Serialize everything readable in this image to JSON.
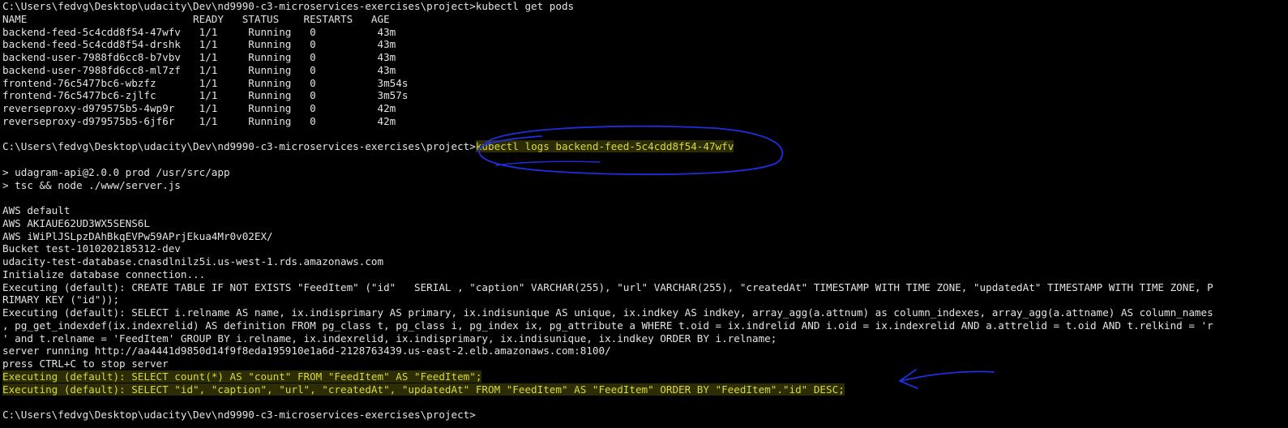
{
  "window": {
    "type": "command-prompt-terminal"
  },
  "colors": {
    "background": "#000000",
    "foreground": "#d4d4d4",
    "highlight_text": "#d9d938",
    "annotation": "#1f2fe0"
  },
  "lines": [
    {
      "text": "C:\\Users\\fedvg\\Desktop\\udacity\\Dev\\nd9990-c3-microservices-exercises\\project>kubectl get pods",
      "style": "normal"
    },
    {
      "text": "NAME                           READY   STATUS    RESTARTS   AGE",
      "style": "normal"
    },
    {
      "text": "backend-feed-5c4cdd8f54-47wfv   1/1     Running   0          43m",
      "style": "normal"
    },
    {
      "text": "backend-feed-5c4cdd8f54-drshk   1/1     Running   0          43m",
      "style": "normal"
    },
    {
      "text": "backend-user-7988fd6cc8-b7vbv   1/1     Running   0          43m",
      "style": "normal"
    },
    {
      "text": "backend-user-7988fd6cc8-ml7zf   1/1     Running   0          43m",
      "style": "normal"
    },
    {
      "text": "frontend-76c5477bc6-wbzfz       1/1     Running   0          3m54s",
      "style": "normal"
    },
    {
      "text": "frontend-76c5477bc6-zjlfc       1/1     Running   0          3m57s",
      "style": "normal"
    },
    {
      "text": "reverseproxy-d979575b5-4wp9r    1/1     Running   0          42m",
      "style": "normal"
    },
    {
      "text": "reverseproxy-d979575b5-6jf6r    1/1     Running   0          42m",
      "style": "normal"
    },
    {
      "text": "",
      "style": "normal"
    },
    {
      "text": "C:\\Users\\fedvg\\Desktop\\udacity\\Dev\\nd9990-c3-microservices-exercises\\project>",
      "suffix": "kubectl logs backend-feed-5c4cdd8f54-47wfv",
      "style": "prompt-highlight"
    },
    {
      "text": "",
      "style": "normal"
    },
    {
      "text": "> udagram-api@2.0.0 prod /usr/src/app",
      "style": "normal"
    },
    {
      "text": "> tsc && node ./www/server.js",
      "style": "normal"
    },
    {
      "text": "",
      "style": "normal"
    },
    {
      "text": "AWS default",
      "style": "normal"
    },
    {
      "text": "AWS AKIAUE62UD3WX5SENS6L",
      "style": "normal"
    },
    {
      "text": "AWS iWiPlJSLpzDAhBkqEVPw59APrjEkua4Mr0v02EX/",
      "style": "normal"
    },
    {
      "text": "Bucket test-1010202185312-dev",
      "style": "normal"
    },
    {
      "text": "udacity-test-database.cnasdlnilz5i.us-west-1.rds.amazonaws.com",
      "style": "normal"
    },
    {
      "text": "Initialize database connection...",
      "style": "normal"
    },
    {
      "text": "Executing (default): CREATE TABLE IF NOT EXISTS \"FeedItem\" (\"id\"   SERIAL , \"caption\" VARCHAR(255), \"url\" VARCHAR(255), \"createdAt\" TIMESTAMP WITH TIME ZONE, \"updatedAt\" TIMESTAMP WITH TIME ZONE, P",
      "style": "normal"
    },
    {
      "text": "RIMARY KEY (\"id\"));",
      "style": "normal"
    },
    {
      "text": "Executing (default): SELECT i.relname AS name, ix.indisprimary AS primary, ix.indisunique AS unique, ix.indkey AS indkey, array_agg(a.attnum) as column_indexes, array_agg(a.attname) AS column_names",
      "style": "normal"
    },
    {
      "text": ", pg_get_indexdef(ix.indexrelid) AS definition FROM pg_class t, pg_class i, pg_index ix, pg_attribute a WHERE t.oid = ix.indrelid AND i.oid = ix.indexrelid AND a.attrelid = t.oid AND t.relkind = 'r",
      "style": "normal"
    },
    {
      "text": "' and t.relname = 'FeedItem' GROUP BY i.relname, ix.indexrelid, ix.indisprimary, ix.indisunique, ix.indkey ORDER BY i.relname;",
      "style": "normal"
    },
    {
      "text": "server running http://aa4441d9850d14f9f8eda195910e1a6d-2128763439.us-east-2.elb.amazonaws.com:8100/",
      "style": "normal"
    },
    {
      "text": "press CTRL+C to stop server",
      "style": "normal"
    },
    {
      "text": "Executing (default): SELECT count(*) AS \"count\" FROM \"FeedItem\" AS \"FeedItem\";",
      "style": "yellow"
    },
    {
      "text": "Executing (default): SELECT \"id\", \"caption\", \"url\", \"createdAt\", \"updatedAt\" FROM \"FeedItem\" AS \"FeedItem\" ORDER BY \"FeedItem\".\"id\" DESC;",
      "style": "yellow"
    },
    {
      "text": "",
      "style": "normal"
    },
    {
      "text": "C:\\Users\\fedvg\\Desktop\\udacity\\Dev\\nd9990-c3-microservices-exercises\\project>",
      "style": "normal"
    }
  ]
}
